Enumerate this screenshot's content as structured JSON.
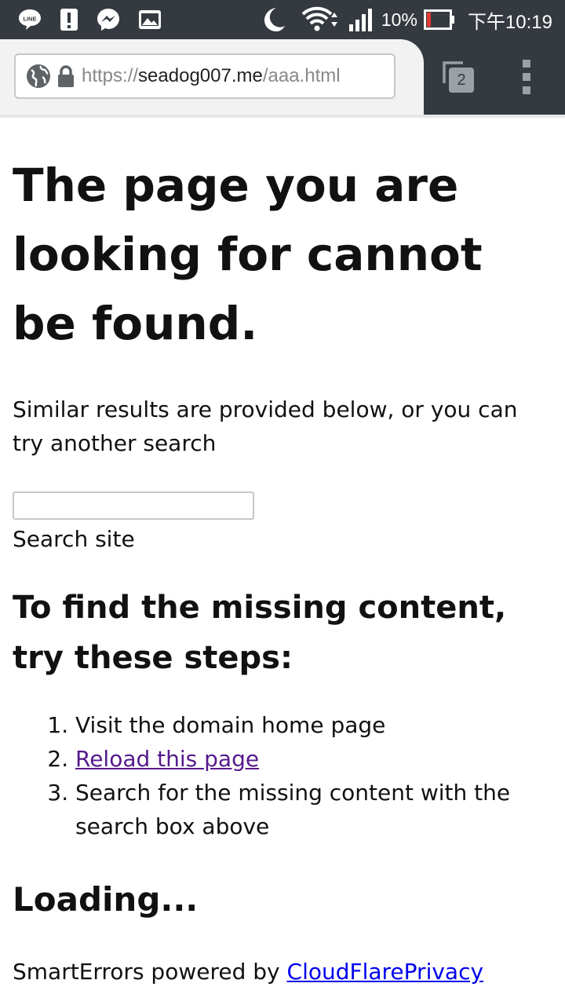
{
  "status_bar": {
    "battery_percent": "10%",
    "clock": "下午10:19",
    "icons": [
      "line-icon",
      "alert-icon",
      "messenger-icon",
      "gallery-icon",
      "moon-icon",
      "wifi-icon",
      "signal-icon",
      "battery-icon"
    ],
    "battery_level": 0.1,
    "line_label": "LINE"
  },
  "browser": {
    "url_scheme": "https://",
    "url_host": "seadog007.me",
    "url_path": "/aaa.html",
    "tab_count": "2"
  },
  "page": {
    "title": "The page you are looking for cannot be found.",
    "intro": "Similar results are provided below, or you can try another search",
    "search_placeholder": "",
    "search_label": "Search site",
    "steps_heading": "To find the missing content, try these steps:",
    "steps": [
      "Visit the domain home page",
      "Reload this page",
      "Search for the missing content with the search box above"
    ],
    "loading": "Loading...",
    "footer_prefix": "SmartErrors powered by ",
    "footer_link": "CloudFlarePrivacy"
  },
  "colors": {
    "status_bar_bg": "#353a40",
    "visited_link": "#551a8b",
    "link": "#0000ee",
    "battery_low": "#e53935"
  }
}
